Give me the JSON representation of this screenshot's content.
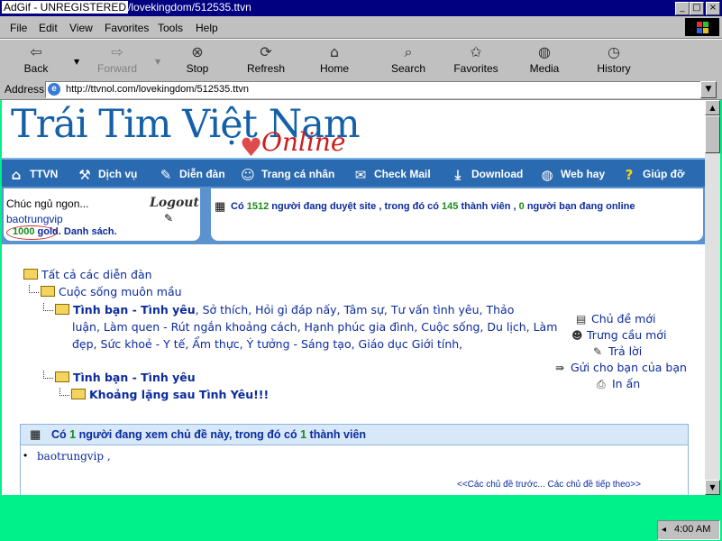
{
  "window": {
    "title_unreg": "AdGif - UNREGISTERED",
    "title_rest": "/lovekingdom/512535.ttvn",
    "min": "_",
    "max": "□",
    "close": "×"
  },
  "menu": [
    "File",
    "Edit",
    "View",
    "Favorites",
    "Tools",
    "Help"
  ],
  "toolbar": {
    "back": "Back",
    "forward": "Forward",
    "stop": "Stop",
    "refresh": "Refresh",
    "home": "Home",
    "search": "Search",
    "favorites": "Favorites",
    "media": "Media",
    "history": "History"
  },
  "address": {
    "label": "Address",
    "url": "http://ttvnol.com/lovekingdom/512535.ttvn"
  },
  "logo": {
    "title": "Trái Tim Việt Nam",
    "subtitle": "Online"
  },
  "nav": [
    "TTVN",
    "Dịch vụ",
    "Diễn đàn",
    "Trang cá nhân",
    "Check Mail",
    "Download",
    "Web hay",
    "Giúp đỡ"
  ],
  "user": {
    "greeting": "Chúc ngủ ngon...",
    "username": "baotrungvip",
    "logout": "Logout",
    "gold_amount": "1000",
    "gold_label": "gold.",
    "list_label": "Danh sách."
  },
  "stats": {
    "prefix": "Có",
    "visitors": "1512",
    "mid1": "người đang duyệt site , trong đó có",
    "members": "145",
    "mid2": "thành viên ,",
    "friends": "0",
    "suffix": "người bạn đang online"
  },
  "tree": {
    "all_forums": "Tất cả các diễn đàn",
    "cuoc_song": "Cuộc sống muôn mầu",
    "tinh_ban_bold": "Tình bạn - Tình yêu",
    "tinh_ban_line1": ", Sở thích, Hỏi gì đáp nấy, Tâm sự, Tư vấn tình yêu, Thảo",
    "tinh_ban_line2": "luận, Làm quen - Rút ngắn khoảng cách, Hạnh phúc gia đình, Cuộc sống, Du lịch, Làm",
    "tinh_ban_line3": "đẹp, Sức khoẻ - Y tế, Ẩm thực, Ý tưởng - Sáng tạo, Giáo dục Giới tính,",
    "tinh_ban_2": "Tình bạn - Tình yêu",
    "thread": "Khoảng lặng sau Tình Yêu!!!"
  },
  "actions": {
    "new_topic": "Chủ đề mới",
    "new_poll": "Trưng cầu mới",
    "reply": "Trả lời",
    "send_friend": "Gửi cho bạn của bạn",
    "print": "In ấn"
  },
  "viewers": {
    "prefix": "Có",
    "count": "1",
    "mid": "người đang xem chủ đề này, trong đó có",
    "members": "1",
    "suffix": "thành viên",
    "user": "baotrungvip",
    "user_sep": ",",
    "pager": "<<Các chủ đề trước... Các chủ đề tiếp theo>>"
  },
  "taskbar": {
    "clock": "4:00 AM"
  },
  "colors": {
    "nav_bg": "#2a6ab0",
    "desktop": "#00f08a",
    "link": "#0a2a9e"
  }
}
